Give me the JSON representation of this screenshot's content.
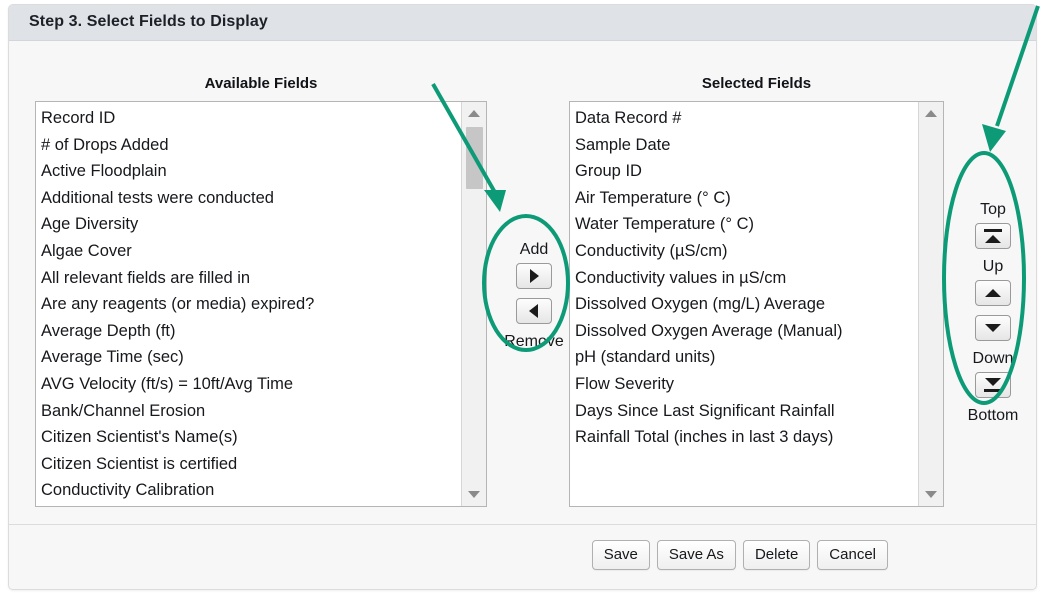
{
  "header": {
    "title": "Step 3. Select Fields to Display"
  },
  "columns": {
    "available_title": "Available Fields",
    "selected_title": "Selected Fields"
  },
  "available_fields": [
    "Record ID",
    "# of Drops Added",
    "Active Floodplain",
    "Additional tests were conducted",
    "Age Diversity",
    "Algae Cover",
    "All relevant fields are filled in",
    "Are any reagents (or media) expired?",
    "Average Depth (ft)",
    "Average Time (sec)",
    "AVG Velocity (ft/s) = 10ft/Avg Time",
    "Bank/Channel Erosion",
    "Citizen Scientist's Name(s)",
    "Citizen Scientist is certified",
    "Conductivity Calibration"
  ],
  "selected_fields": [
    "Data Record #",
    "Sample Date",
    "Group ID",
    "Air Temperature (° C)",
    "Water Temperature (° C)",
    "Conductivity (µS/cm)",
    "Conductivity values in µS/cm",
    "Dissolved Oxygen (mg/L) Average",
    "Dissolved Oxygen Average (Manual)",
    "pH (standard units)",
    "Flow Severity",
    "Days Since Last Significant Rainfall",
    "Rainfall Total (inches in last 3 days)"
  ],
  "transfer_controls": {
    "add_label": "Add",
    "remove_label": "Remove"
  },
  "reorder_controls": {
    "top_label": "Top",
    "up_label": "Up",
    "down_label": "Down",
    "bottom_label": "Bottom"
  },
  "footer_buttons": [
    {
      "label": "Save"
    },
    {
      "label": "Save As"
    },
    {
      "label": "Delete"
    },
    {
      "label": "Cancel"
    }
  ],
  "colors": {
    "annotation": "#0d9b77",
    "header_bar": "#dfe3e8",
    "panel_bg": "#f7f7f7",
    "listbox_bg": "#ffffff",
    "text": "#17181c"
  }
}
